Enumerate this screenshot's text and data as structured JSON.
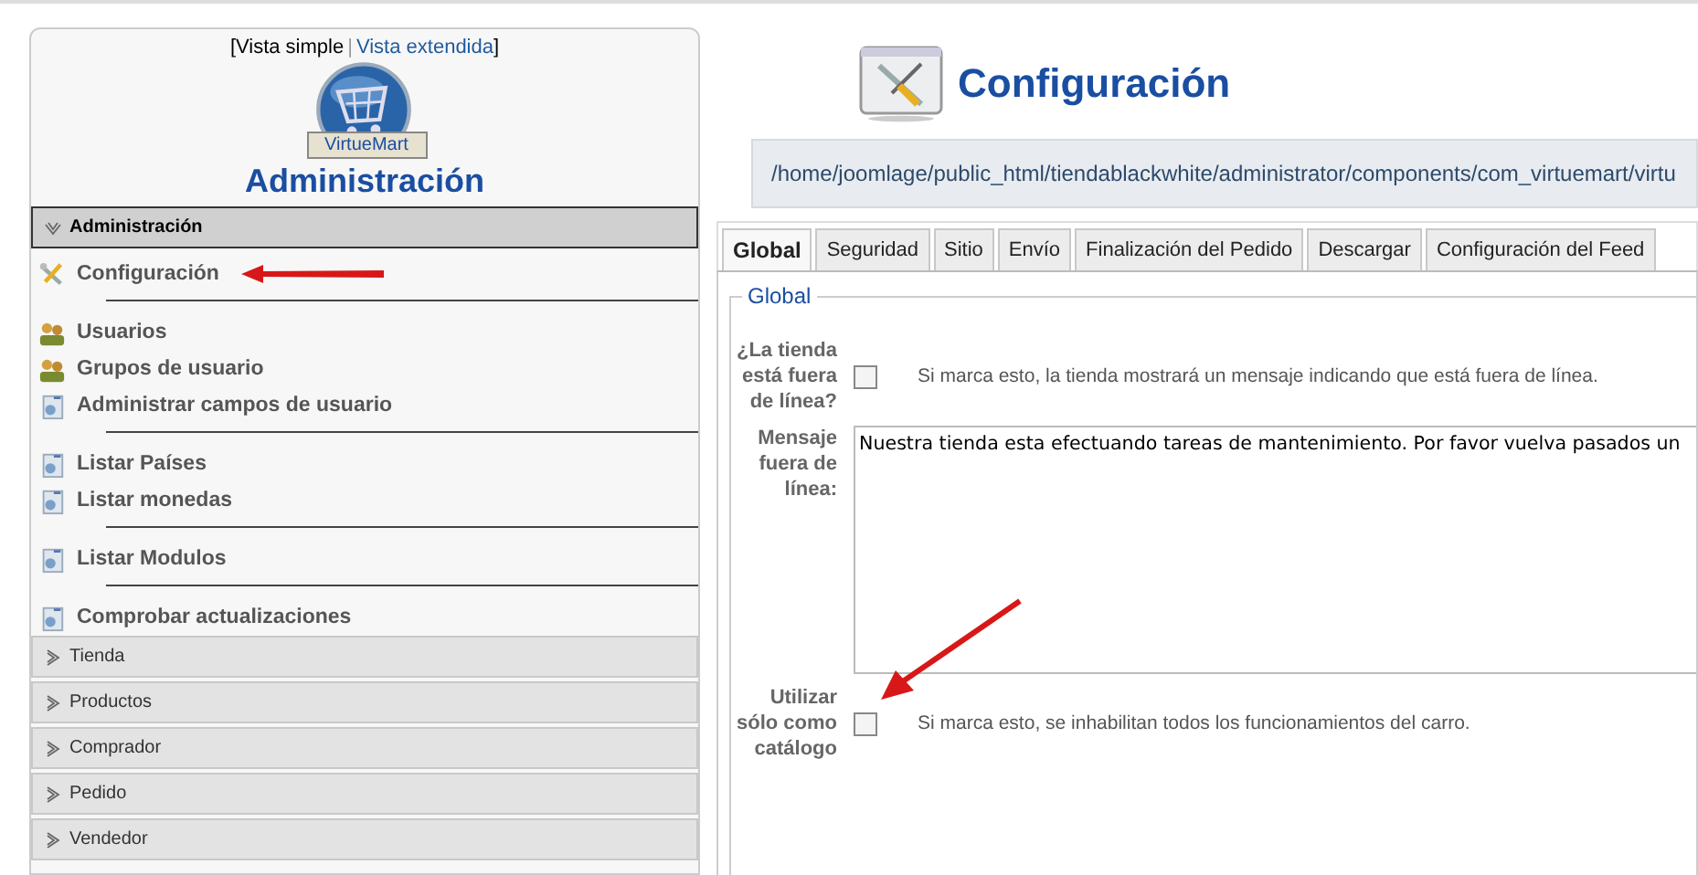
{
  "sidebar": {
    "view_switch": {
      "open": "[",
      "separator": "|",
      "close": "]",
      "links": [
        {
          "label": "Vista simple",
          "selected": true
        },
        {
          "label": "Vista extendida",
          "selected": false
        }
      ]
    },
    "logo_text": "VirtueMart",
    "heading": "Administración",
    "sections": [
      {
        "title": "Administración",
        "expanded": true,
        "items": [
          {
            "label": "Configuración",
            "kind": "tools",
            "divider_after": true
          },
          {
            "label": "Usuarios",
            "kind": "users",
            "divider_after": false
          },
          {
            "label": "Grupos de usuario",
            "kind": "users",
            "divider_after": false
          },
          {
            "label": "Administrar campos de usuario",
            "kind": "doc",
            "divider_after": true
          },
          {
            "label": "Listar Países",
            "kind": "doc",
            "divider_after": false
          },
          {
            "label": "Listar monedas",
            "kind": "doc",
            "divider_after": true
          },
          {
            "label": "Listar Modulos",
            "kind": "doc",
            "divider_after": true
          },
          {
            "label": "Comprobar actualizaciones",
            "kind": "doc",
            "divider_after": false
          }
        ]
      },
      {
        "title": "Tienda",
        "expanded": false
      },
      {
        "title": "Productos",
        "expanded": false
      },
      {
        "title": "Comprador",
        "expanded": false
      },
      {
        "title": "Pedido",
        "expanded": false
      },
      {
        "title": "Vendedor",
        "expanded": false
      }
    ]
  },
  "page": {
    "title": "Configuración",
    "path": "/home/joomlage/public_html/tiendablackwhite/administrator/components/com_virtuemart/virtu"
  },
  "tabs": [
    {
      "label": "Global",
      "selected": true
    },
    {
      "label": "Seguridad",
      "selected": false
    },
    {
      "label": "Sitio",
      "selected": false
    },
    {
      "label": "Envío",
      "selected": false
    },
    {
      "label": "Finalización del Pedido",
      "selected": false
    },
    {
      "label": "Descargar",
      "selected": false
    },
    {
      "label": "Configuración del Feed",
      "selected": false
    }
  ],
  "fieldset": {
    "legend": "Global",
    "rows": [
      {
        "kind": "checkbox",
        "label": "¿La tienda está fuera de línea?",
        "checked": false,
        "description": "Si marca esto, la tienda mostrará un mensaje indicando que está fuera de línea."
      },
      {
        "kind": "textarea",
        "label": "Mensaje fuera de línea:",
        "value": "Nuestra tienda esta efectuando tareas de mantenimiento. Por favor vuelva pasados un"
      },
      {
        "kind": "checkbox",
        "label": "Utilizar sólo como catálogo",
        "checked": false,
        "description": "Si marca esto, se inhabilitan todos los funcionamientos del carro."
      }
    ]
  }
}
